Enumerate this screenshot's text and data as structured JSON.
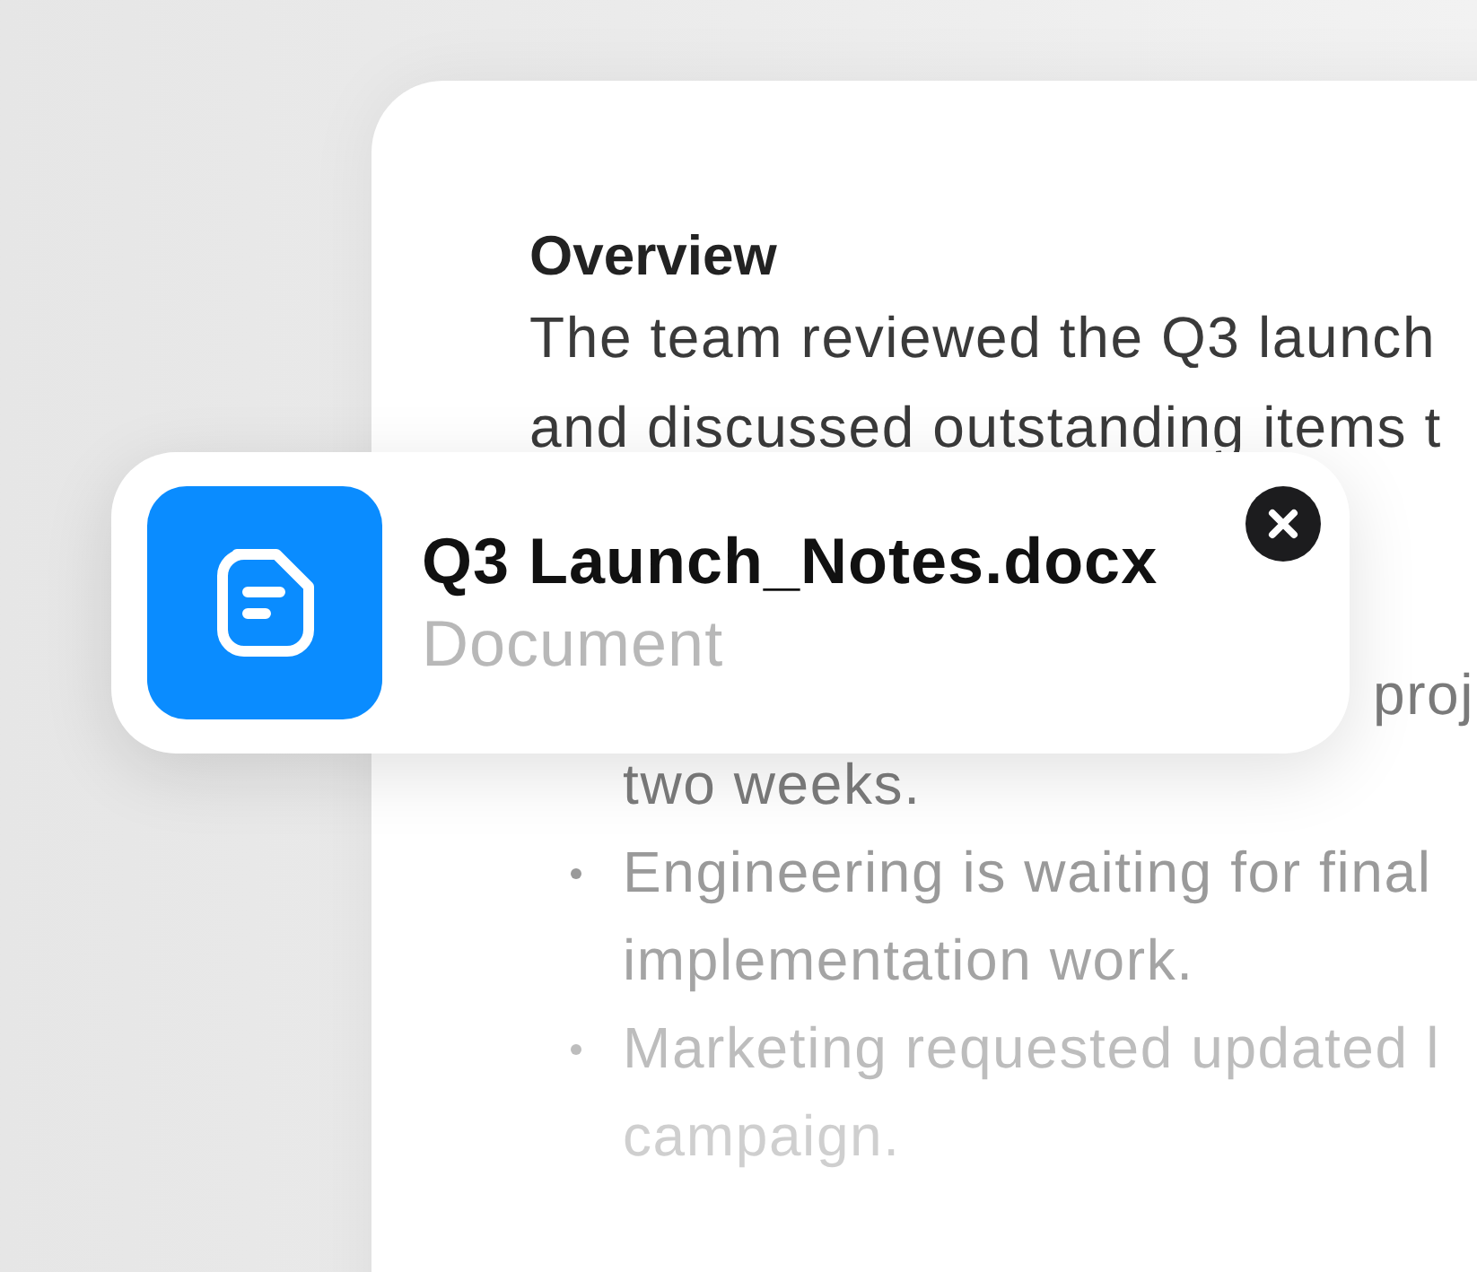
{
  "document": {
    "heading": "Overview",
    "paragraph_lines": [
      "The team reviewed the Q3 launch",
      "and discussed outstanding items t"
    ],
    "bullets": [
      {
        "lines": [
          "proj",
          "two weeks."
        ]
      },
      {
        "lines": [
          "Engineering is waiting for final",
          "implementation work."
        ]
      },
      {
        "lines": [
          "Marketing requested updated l",
          "campaign."
        ]
      }
    ]
  },
  "attachment": {
    "file_name": "Q3 Launch_Notes.docx",
    "file_type": "Document"
  }
}
